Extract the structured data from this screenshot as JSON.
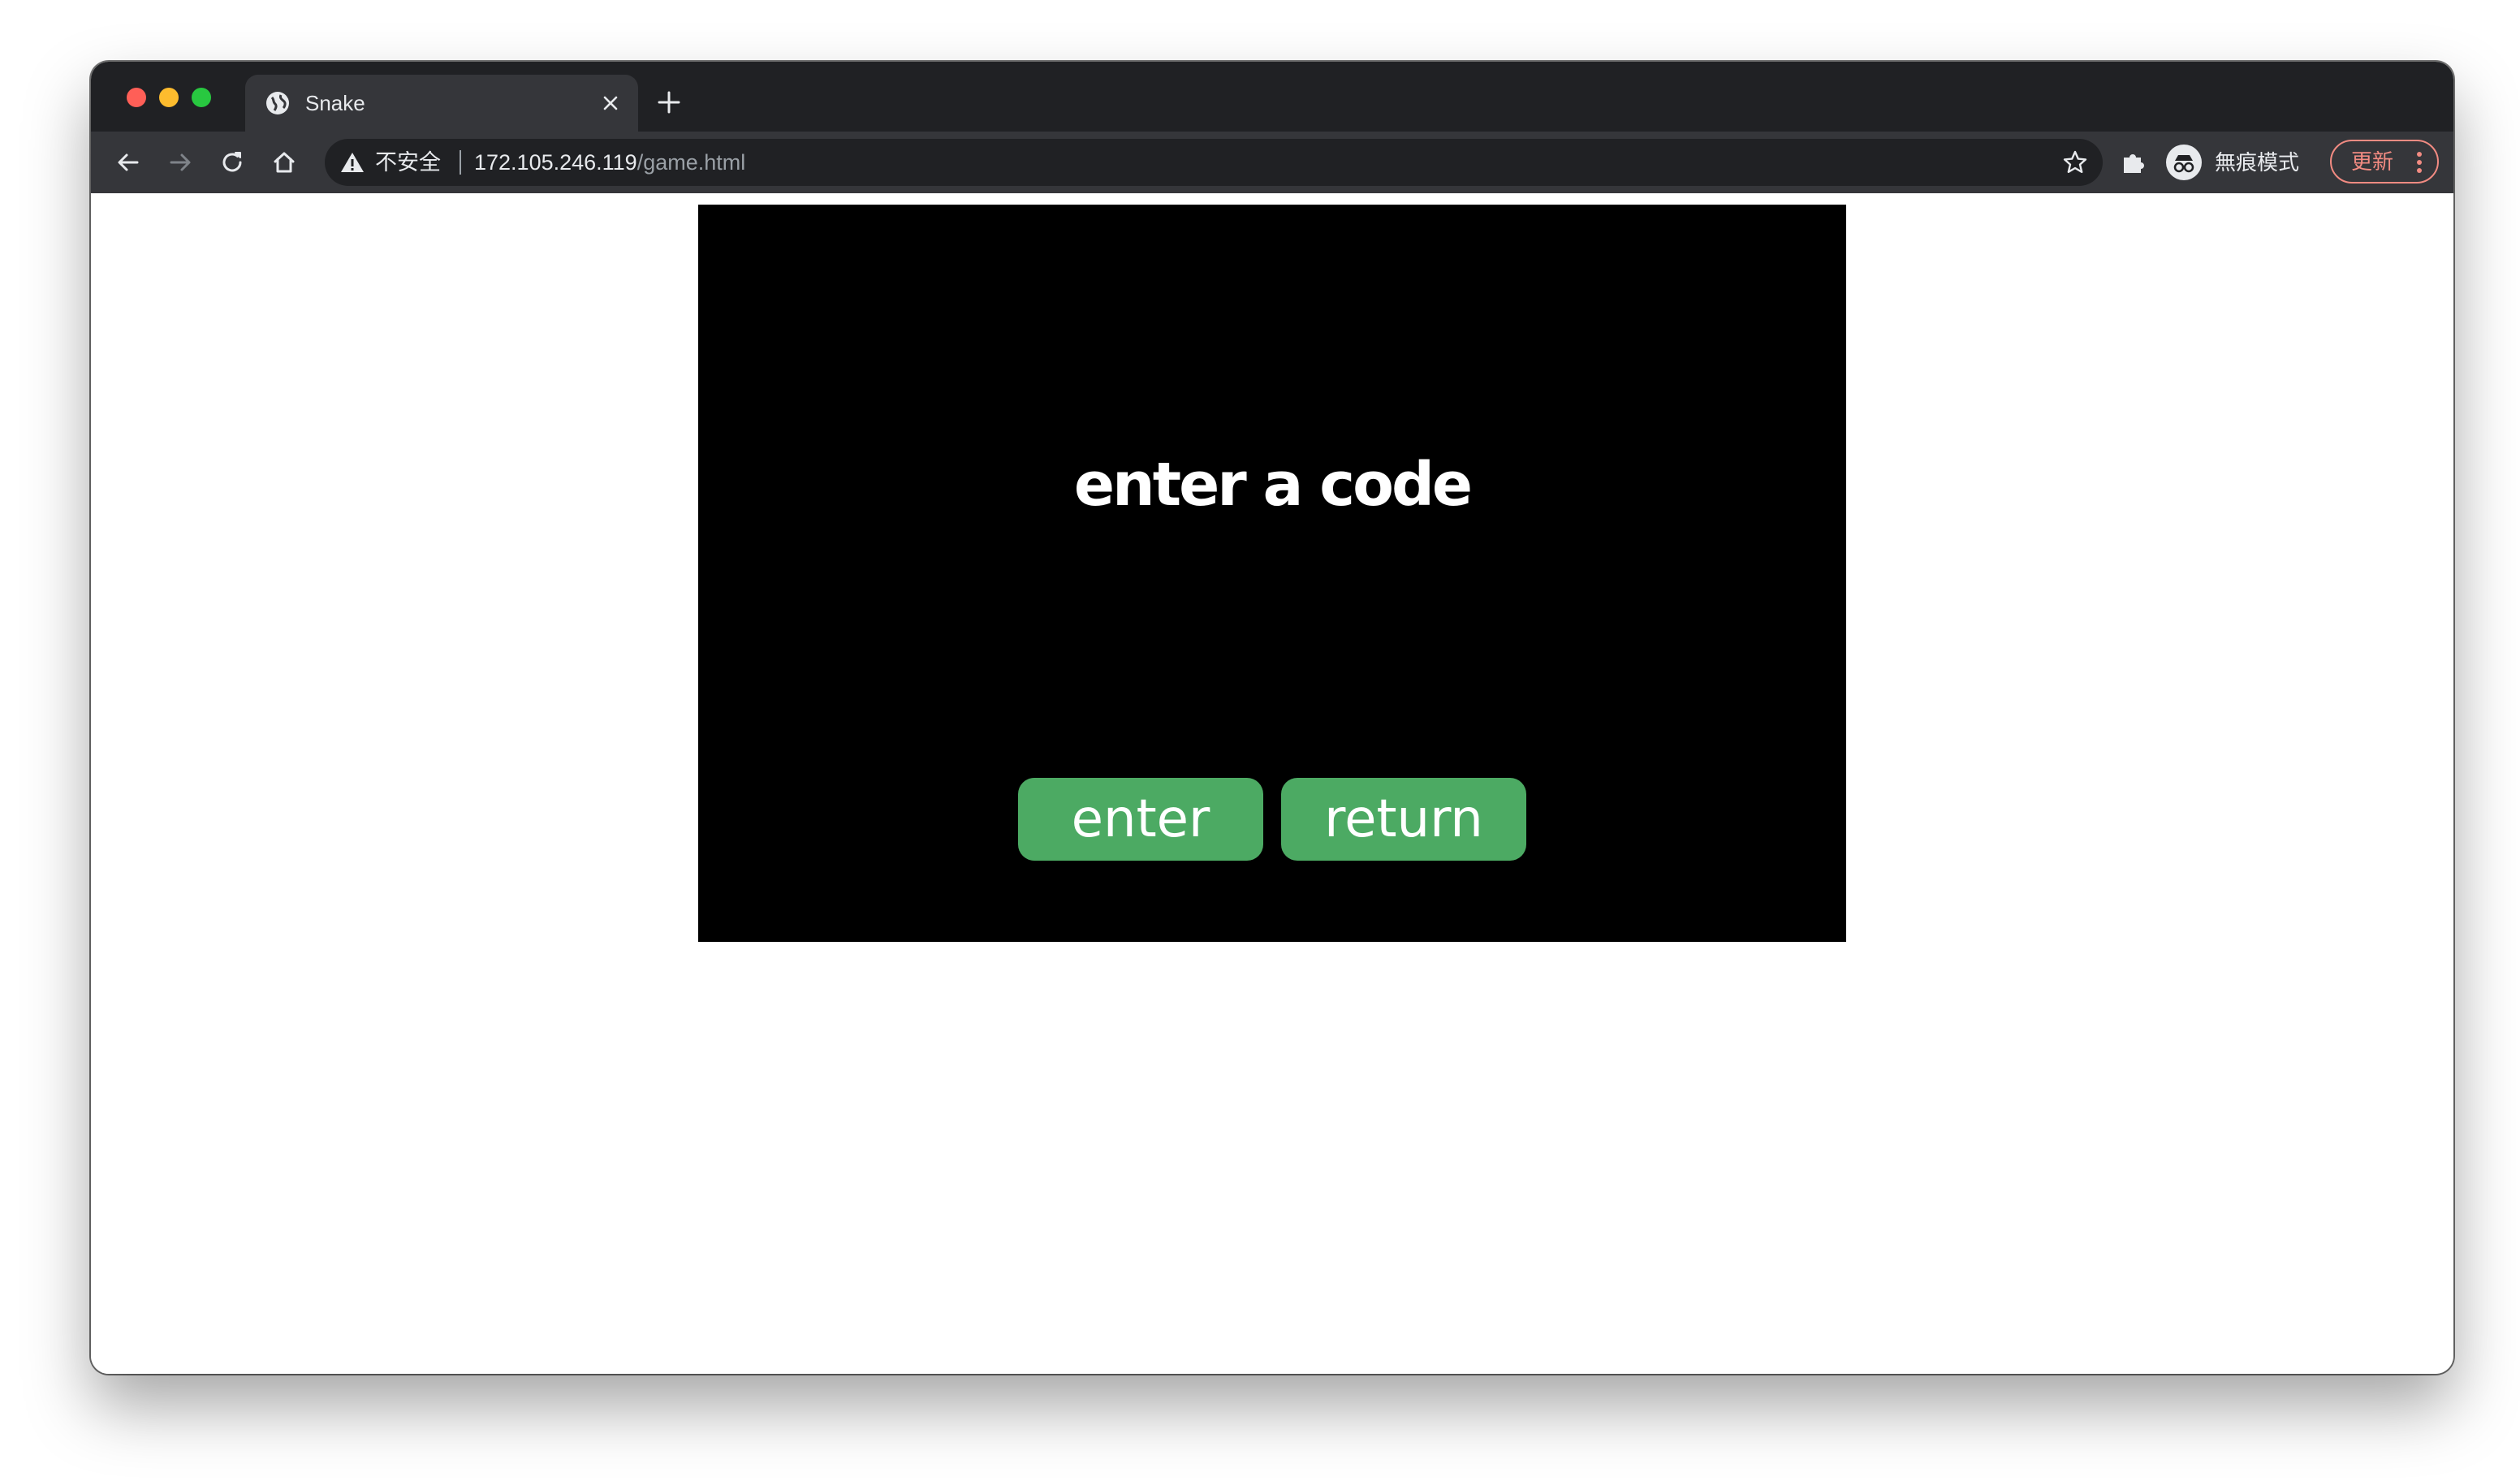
{
  "browser": {
    "tab": {
      "title": "Snake",
      "icon": "globe-icon"
    },
    "toolbar": {
      "back_icon": "back-arrow-icon",
      "forward_icon": "forward-arrow-icon",
      "reload_icon": "reload-icon",
      "home_icon": "home-icon",
      "security_label": "不安全",
      "url_host": "172.105.246.119",
      "url_path": "/game.html",
      "bookmark_icon": "star-icon",
      "extensions_icon": "puzzle-icon",
      "incognito_label": "無痕模式",
      "update_label": "更新"
    },
    "colors": {
      "frame": "#202124",
      "toolbar": "#35363a",
      "update_accent": "#f28b82"
    }
  },
  "game": {
    "title": "enter a code",
    "buttons": {
      "enter": "enter",
      "return": "return"
    },
    "colors": {
      "background": "#000000",
      "button": "#4caa63",
      "text": "#ffffff"
    }
  }
}
